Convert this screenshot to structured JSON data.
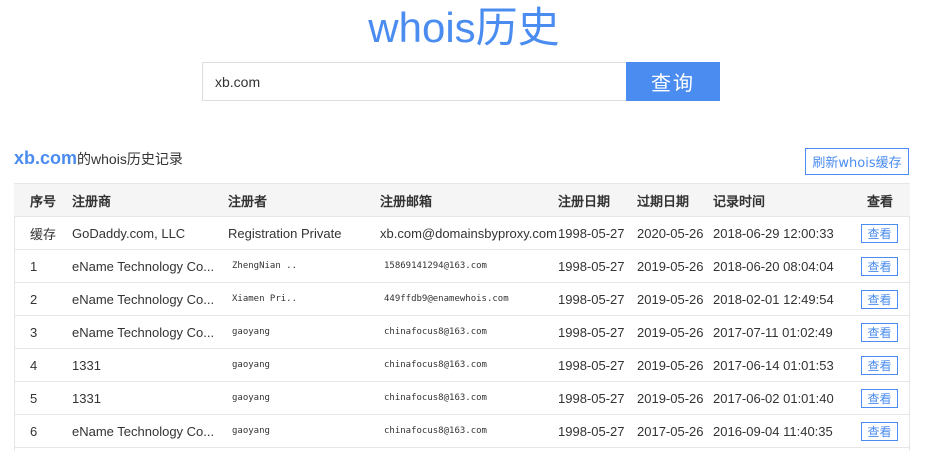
{
  "header": {
    "title": "whois历史"
  },
  "search": {
    "value": "xb.com",
    "button_label": "查询"
  },
  "section": {
    "domain": "xb.com",
    "suffix": "的whois历史记录",
    "refresh_label": "刷新whois缓存"
  },
  "table": {
    "columns": [
      "序号",
      "注册商",
      "注册者",
      "注册邮箱",
      "注册日期",
      "过期日期",
      "记录时间",
      "查看"
    ],
    "rows": [
      {
        "no": "缓存",
        "registrar": "GoDaddy.com, LLC",
        "registrant": "Registration Private",
        "email": "xb.com@domainsbyproxy.com",
        "reg_date": "1998-05-27",
        "exp_date": "2020-05-26",
        "record_time": "2018-06-29 12:00:33",
        "view": "查看"
      },
      {
        "no": "1",
        "registrar": "eName Technology Co...",
        "registrant": "ZhengNian ..",
        "email": "15869141294@163.com",
        "reg_date": "1998-05-27",
        "exp_date": "2019-05-26",
        "record_time": "2018-06-20 08:04:04",
        "view": "查看"
      },
      {
        "no": "2",
        "registrar": "eName Technology Co...",
        "registrant": "Xiamen Pri..",
        "email": "449ffdb9@enamewhois.com",
        "reg_date": "1998-05-27",
        "exp_date": "2019-05-26",
        "record_time": "2018-02-01 12:49:54",
        "view": "查看"
      },
      {
        "no": "3",
        "registrar": "eName Technology Co...",
        "registrant": "gaoyang",
        "email": "chinafocus8@163.com",
        "reg_date": "1998-05-27",
        "exp_date": "2019-05-26",
        "record_time": "2017-07-11 01:02:49",
        "view": "查看"
      },
      {
        "no": "4",
        "registrar": "1331",
        "registrant": "gaoyang",
        "email": "chinafocus8@163.com",
        "reg_date": "1998-05-27",
        "exp_date": "2019-05-26",
        "record_time": "2017-06-14 01:01:53",
        "view": "查看"
      },
      {
        "no": "5",
        "registrar": "1331",
        "registrant": "gaoyang",
        "email": "chinafocus8@163.com",
        "reg_date": "1998-05-27",
        "exp_date": "2019-05-26",
        "record_time": "2017-06-02 01:01:40",
        "view": "查看"
      },
      {
        "no": "6",
        "registrar": "eName Technology Co...",
        "registrant": "gaoyang",
        "email": "chinafocus8@163.com",
        "reg_date": "1998-05-27",
        "exp_date": "2017-05-26",
        "record_time": "2016-09-04 11:40:35",
        "view": "查看"
      }
    ]
  },
  "colors": {
    "accent": "#4a8cf0",
    "header_bg": "#f5f5f5",
    "border": "#e6e6e6"
  }
}
